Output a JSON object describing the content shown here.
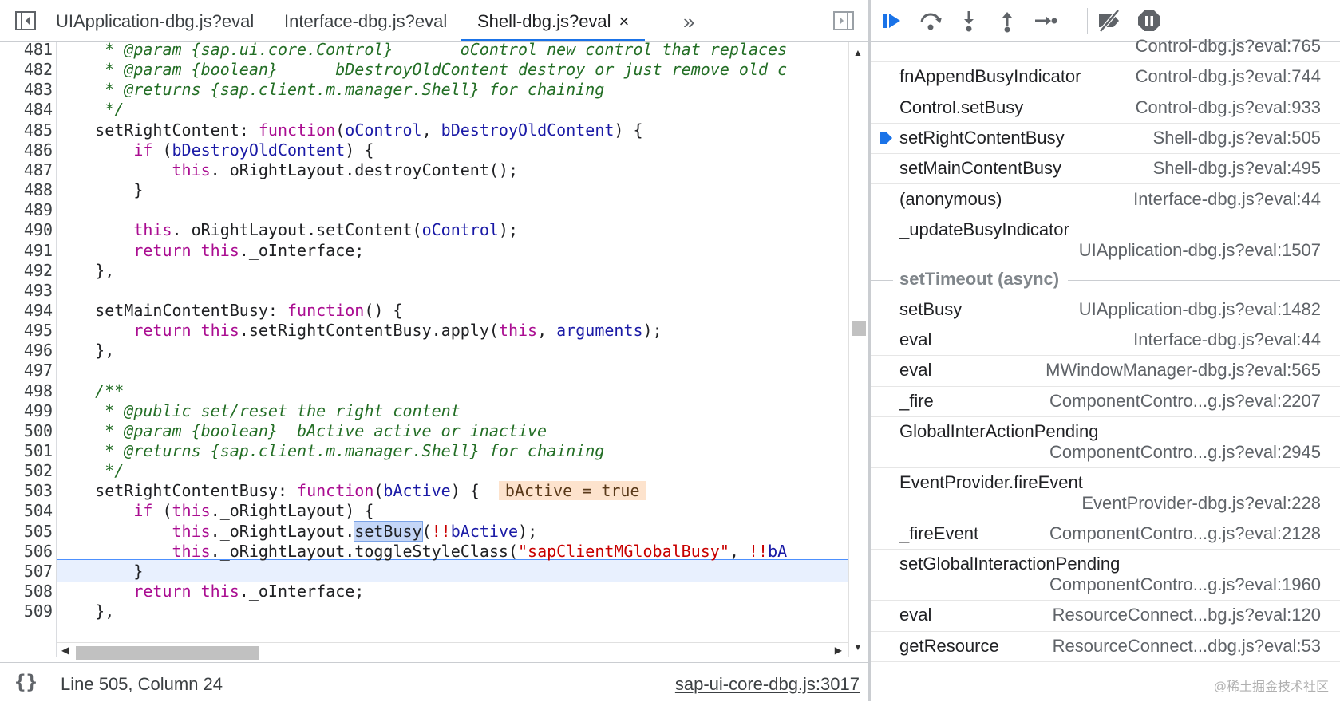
{
  "editor": {
    "tabs": [
      {
        "label": "UIApplication-dbg.js?eval"
      },
      {
        "label": "Interface-dbg.js?eval"
      },
      {
        "label": "Shell-dbg.js?eval",
        "close": "×"
      }
    ],
    "more_tabs": "»",
    "lines": [
      {
        "n": "481",
        "html": "<span class=\"c\">     * @param {sap.ui.core.Control}       oControl new control that replaces</span>"
      },
      {
        "n": "482",
        "html": "<span class=\"c\">     * @param {boolean}      bDestroyOldContent destroy or just remove old c</span>"
      },
      {
        "n": "483",
        "html": "<span class=\"c\">     * @returns {sap.client.m.manager.Shell} for chaining</span>"
      },
      {
        "n": "484",
        "html": "<span class=\"c\">     */</span>"
      },
      {
        "n": "485",
        "html": "    setRightContent: <span class=\"k\">function</span>(<span class=\"v\">oControl</span>, <span class=\"v\">bDestroyOldContent</span>) {"
      },
      {
        "n": "486",
        "html": "        <span class=\"k\">if</span> (<span class=\"v\">bDestroyOldContent</span>) {"
      },
      {
        "n": "487",
        "html": "            <span class=\"k\">this</span>._oRightLayout.destroyContent();"
      },
      {
        "n": "488",
        "html": "        }"
      },
      {
        "n": "489",
        "html": ""
      },
      {
        "n": "490",
        "html": "        <span class=\"k\">this</span>._oRightLayout.setContent(<span class=\"v\">oControl</span>);"
      },
      {
        "n": "491",
        "html": "        <span class=\"k\">return</span> <span class=\"k\">this</span>._oInterface;"
      },
      {
        "n": "492",
        "html": "    },"
      },
      {
        "n": "493",
        "html": ""
      },
      {
        "n": "494",
        "html": "    setMainContentBusy: <span class=\"k\">function</span>() {"
      },
      {
        "n": "495",
        "html": "        <span class=\"k\">return</span> <span class=\"k\">this</span>.setRightContentBusy.apply(<span class=\"k\">this</span>, <span class=\"v\">arguments</span>);"
      },
      {
        "n": "496",
        "html": "    },"
      },
      {
        "n": "497",
        "html": ""
      },
      {
        "n": "498",
        "html": "<span class=\"c\">    /**</span>"
      },
      {
        "n": "499",
        "html": "<span class=\"c\">     * @public set/reset the right content</span>"
      },
      {
        "n": "500",
        "html": "<span class=\"c\">     * @param {boolean}  bActive active or inactive</span>"
      },
      {
        "n": "501",
        "html": "<span class=\"c\">     * @returns {sap.client.m.manager.Shell} for chaining</span>"
      },
      {
        "n": "502",
        "html": "<span class=\"c\">     */</span>"
      },
      {
        "n": "503",
        "html": "    setRightContentBusy: <span class=\"k\">function</span>(<span class=\"v\">bActive</span>) {  <span class=\"inline-val\">bActive = true</span>"
      },
      {
        "n": "504",
        "html": "        <span class=\"k\">if</span> (<span class=\"k\">this</span>._oRightLayout) {"
      },
      {
        "n": "505",
        "html": "            <span class=\"k\">this</span>._oRightLayout.<span class=\"sel\">setBusy</span>(<span class=\"s\">!!</span><span class=\"v\">bActive</span>);"
      },
      {
        "n": "506",
        "html": "            <span class=\"k\">this</span>._oRightLayout.toggleStyleClass(<span class=\"s\">\"sapClientMGlobalBusy\"</span>, <span class=\"s\">!!</span><span class=\"v\">bA</span>"
      },
      {
        "n": "507",
        "html": "        }"
      },
      {
        "n": "508",
        "html": "        <span class=\"k\">return</span> <span class=\"k\">this</span>._oInterface;"
      },
      {
        "n": "509",
        "html": "    },"
      }
    ]
  },
  "status": {
    "braces": "{}",
    "position": "Line 505, Column 24",
    "source": "sap-ui-core-dbg.js:3017"
  },
  "callstack": [
    {
      "name": "",
      "loc": "Control-dbg.js?eval:765"
    },
    {
      "name": "fnAppendBusyIndicator",
      "loc": "Control-dbg.js?eval:744"
    },
    {
      "name": "Control.setBusy",
      "loc": "Control-dbg.js?eval:933"
    },
    {
      "name": "setRightContentBusy",
      "loc": "Shell-dbg.js?eval:505",
      "current": true
    },
    {
      "name": "setMainContentBusy",
      "loc": "Shell-dbg.js?eval:495"
    },
    {
      "name": "(anonymous)",
      "loc": "Interface-dbg.js?eval:44"
    },
    {
      "name": "_updateBusyIndicator",
      "loc": "UIApplication-dbg.js?eval:1507",
      "twoline": true
    },
    {
      "async": "setTimeout (async)"
    },
    {
      "name": "setBusy",
      "loc": "UIApplication-dbg.js?eval:1482"
    },
    {
      "name": "eval",
      "loc": "Interface-dbg.js?eval:44"
    },
    {
      "name": "eval",
      "loc": "MWindowManager-dbg.js?eval:565"
    },
    {
      "name": "_fire",
      "loc": "ComponentContro...g.js?eval:2207"
    },
    {
      "name": "GlobalInterActionPending",
      "loc": "ComponentContro...g.js?eval:2945",
      "twoline": true
    },
    {
      "name": "EventProvider.fireEvent",
      "loc": "EventProvider-dbg.js?eval:228",
      "twoline": true
    },
    {
      "name": "_fireEvent",
      "loc": "ComponentContro...g.js?eval:2128"
    },
    {
      "name": "setGlobalInteractionPending",
      "loc": "ComponentContro...g.js?eval:1960",
      "twoline": true
    },
    {
      "name": "eval",
      "loc": "ResourceConnect...bg.js?eval:120"
    },
    {
      "name": "getResource",
      "loc": "ResourceConnect...dbg.js?eval:53"
    }
  ],
  "watermark": "@稀土掘金技术社区",
  "colors": {
    "accent": "#1a73e8",
    "keyword": "#aa0d91",
    "comment": "#236e25",
    "variable": "#1a1aa6",
    "string": "#c80000"
  }
}
